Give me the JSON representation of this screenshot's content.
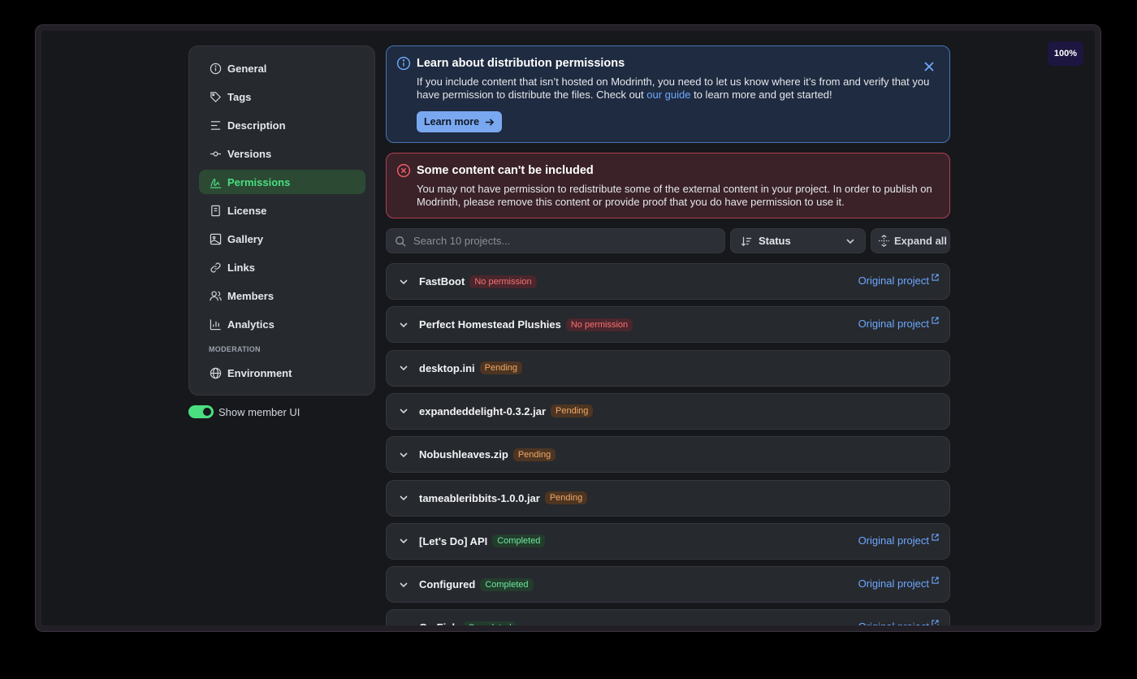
{
  "zoom": "100%",
  "sidebar": {
    "items": [
      {
        "label": "General",
        "icon": "info-circle-icon"
      },
      {
        "label": "Tags",
        "icon": "tag-icon"
      },
      {
        "label": "Description",
        "icon": "align-left-icon"
      },
      {
        "label": "Versions",
        "icon": "commit-icon"
      },
      {
        "label": "Permissions",
        "icon": "signature-icon",
        "active": true
      },
      {
        "label": "License",
        "icon": "book-icon"
      },
      {
        "label": "Gallery",
        "icon": "image-icon"
      },
      {
        "label": "Links",
        "icon": "link-icon"
      },
      {
        "label": "Members",
        "icon": "users-icon"
      },
      {
        "label": "Analytics",
        "icon": "chart-icon"
      }
    ],
    "section_label": "MODERATION",
    "section_items": [
      {
        "label": "Environment",
        "icon": "globe-icon"
      }
    ]
  },
  "toggle": {
    "label": "Show member UI",
    "on": true
  },
  "info_banner": {
    "title": "Learn about distribution permissions",
    "text_before": "If you include content that isn’t hosted on Modrinth, you need to let us know where it’s from and verify that you have permission to distribute the files. Check out ",
    "link": "our guide",
    "text_after": " to learn more and get started!",
    "button": "Learn more"
  },
  "error_banner": {
    "title": "Some content can't be included",
    "text": "You may not have permission to redistribute some of the external content in your project. In order to publish on Modrinth, please remove this content or provide proof that you do have permission to use it."
  },
  "search": {
    "placeholder": "Search 10 projects..."
  },
  "status_filter": {
    "label": "Status"
  },
  "expand_button": "Expand all",
  "colors": {
    "accent": "#4ade80",
    "link": "#6ea8ff",
    "error": "#b04050",
    "info": "#4a73b8"
  },
  "rows": [
    {
      "name": "FastBoot",
      "status": "No permission",
      "kind": "none",
      "link": "Original project"
    },
    {
      "name": "Perfect Homestead Plushies",
      "status": "No permission",
      "kind": "none",
      "link": "Original project"
    },
    {
      "name": "desktop.ini",
      "status": "Pending",
      "kind": "pending",
      "link": ""
    },
    {
      "name": "expandeddelight-0.3.2.jar",
      "status": "Pending",
      "kind": "pending",
      "link": ""
    },
    {
      "name": "Nobushleaves.zip",
      "status": "Pending",
      "kind": "pending",
      "link": ""
    },
    {
      "name": "tameableribbits-1.0.0.jar",
      "status": "Pending",
      "kind": "pending",
      "link": ""
    },
    {
      "name": "[Let's Do] API",
      "status": "Completed",
      "kind": "done",
      "link": "Original project"
    },
    {
      "name": "Configured",
      "status": "Completed",
      "kind": "done",
      "link": "Original project"
    },
    {
      "name": "Go Fish",
      "status": "Completed",
      "kind": "done",
      "link": "Original project"
    }
  ]
}
